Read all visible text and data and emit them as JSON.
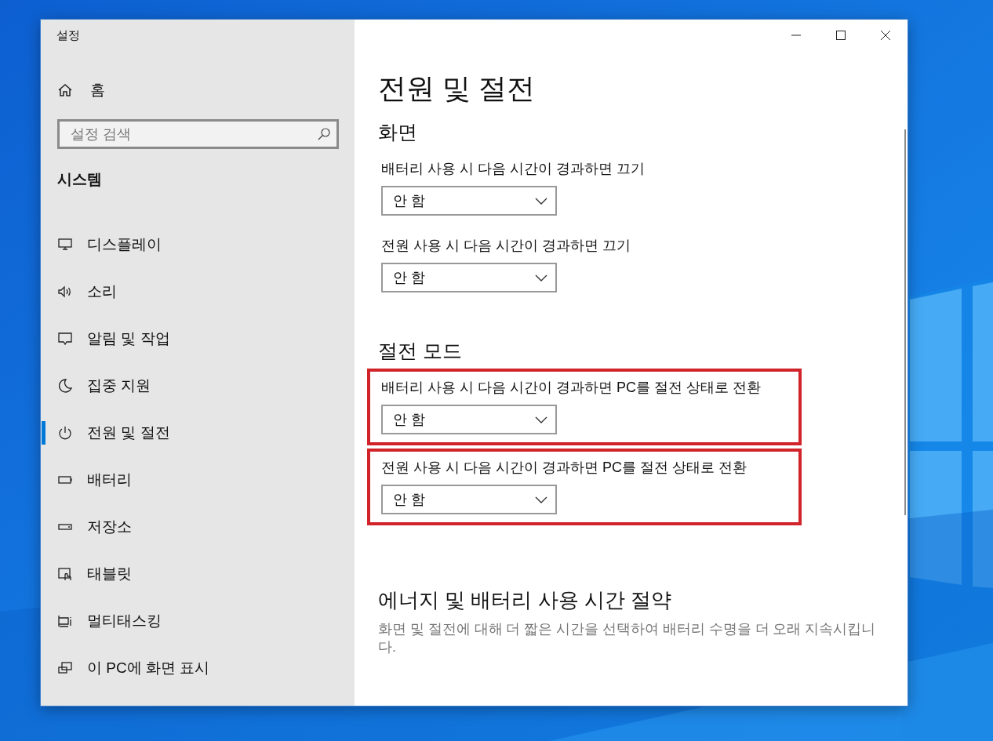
{
  "window": {
    "title": "설정"
  },
  "sidebar": {
    "home": "홈",
    "search": {
      "placeholder": "설정 검색"
    },
    "section": "시스템",
    "items": [
      {
        "label": "디스플레이",
        "selected": false
      },
      {
        "label": "소리",
        "selected": false
      },
      {
        "label": "알림 및 작업",
        "selected": false
      },
      {
        "label": "집중 지원",
        "selected": false
      },
      {
        "label": "전원 및 절전",
        "selected": true
      },
      {
        "label": "배터리",
        "selected": false
      },
      {
        "label": "저장소",
        "selected": false
      },
      {
        "label": "태블릿",
        "selected": false
      },
      {
        "label": "멀티태스킹",
        "selected": false
      },
      {
        "label": "이 PC에 화면 표시",
        "selected": false
      }
    ]
  },
  "page": {
    "title": "전원 및 절전",
    "sections": [
      {
        "heading": "화면",
        "settings": [
          {
            "label": "배터리 사용 시 다음 시간이 경과하면 끄기",
            "value": "안 함",
            "highlighted": false
          },
          {
            "label": "전원 사용 시 다음 시간이 경과하면 끄기",
            "value": "안 함",
            "highlighted": false
          }
        ]
      },
      {
        "heading": "절전 모드",
        "settings": [
          {
            "label": "배터리 사용 시 다음 시간이 경과하면 PC를 절전 상태로 전환",
            "value": "안 함",
            "highlighted": true
          },
          {
            "label": "전원 사용 시 다음 시간이 경과하면 PC를 절전 상태로 전환",
            "value": "안 함",
            "highlighted": true
          }
        ]
      }
    ],
    "energy": {
      "heading": "에너지 및 배터리 사용 시간 절약",
      "text": "화면 및 절전에 대해 더 짧은 시간을 선택하여 배터리 수명을 더 오래 지속시킵니다."
    }
  }
}
